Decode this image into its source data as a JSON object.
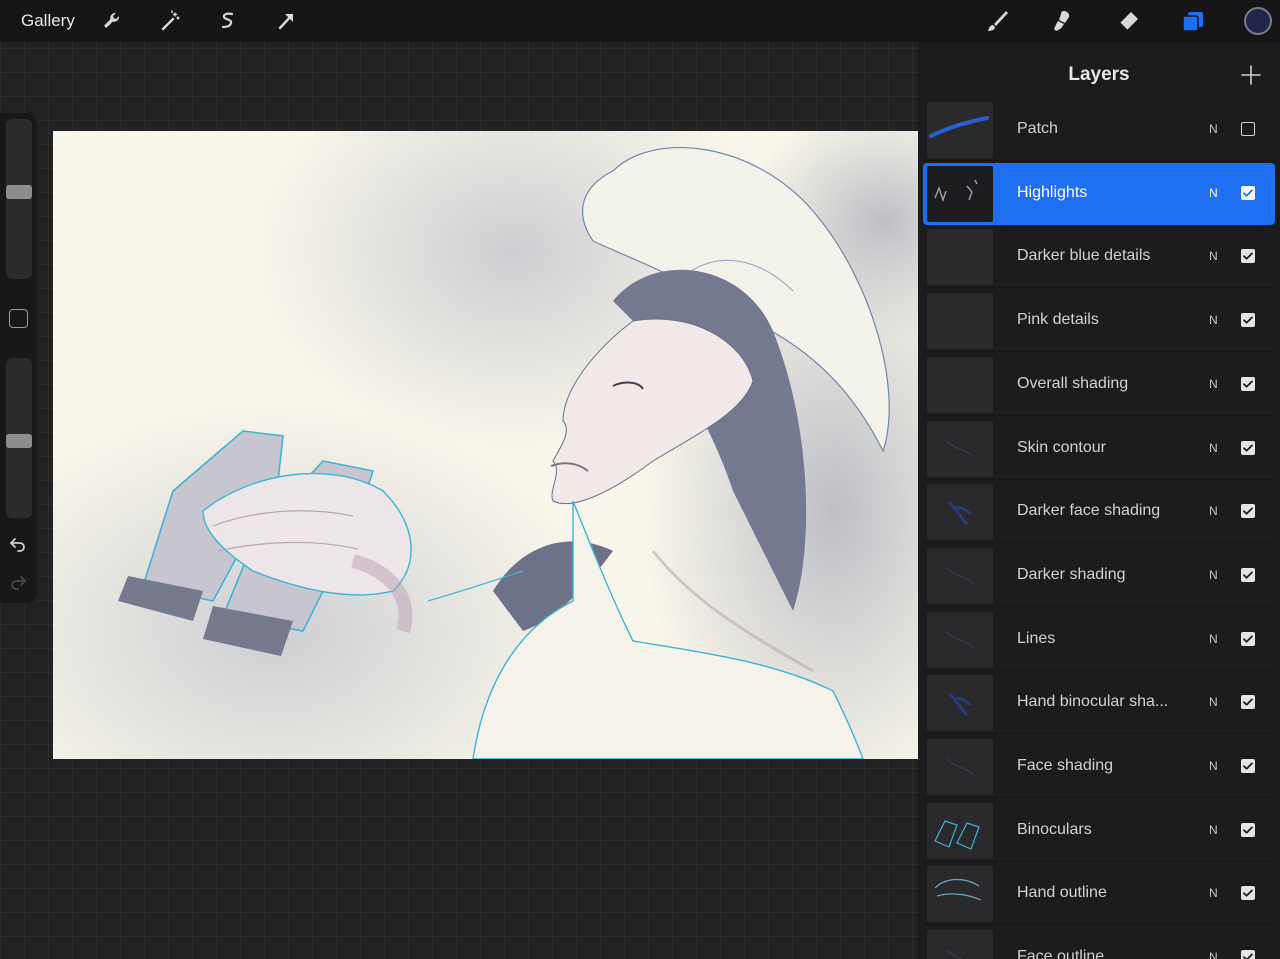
{
  "toolbar": {
    "gallery_label": "Gallery",
    "left_tools": [
      "wrench-icon",
      "magic-wand-icon",
      "selection-icon",
      "transform-arrow-icon"
    ],
    "right_tools": [
      "brush-icon",
      "smudge-icon",
      "eraser-icon",
      "layers-icon"
    ],
    "accent_color": "#1f6ff2",
    "current_color": "#24254a"
  },
  "sidebar": {
    "brush_size_level": 0.45,
    "opacity_level": 0.52,
    "icons": [
      "modify-square-icon",
      "undo-icon",
      "redo-icon"
    ]
  },
  "layers": {
    "title": "Layers",
    "add_icon": "plus-icon",
    "items": [
      {
        "name": "Patch",
        "mode": "N",
        "visible": false,
        "active": false,
        "thumb": "patch"
      },
      {
        "name": "Highlights",
        "mode": "N",
        "visible": true,
        "active": true,
        "thumb": "highlights"
      },
      {
        "name": "Darker blue details",
        "mode": "N",
        "visible": true,
        "active": false,
        "thumb": "empty"
      },
      {
        "name": "Pink details",
        "mode": "N",
        "visible": true,
        "active": false,
        "thumb": "empty"
      },
      {
        "name": "Overall shading",
        "mode": "N",
        "visible": true,
        "active": false,
        "thumb": "empty"
      },
      {
        "name": "Skin contour",
        "mode": "N",
        "visible": true,
        "active": false,
        "thumb": "faint"
      },
      {
        "name": "Darker face shading",
        "mode": "N",
        "visible": true,
        "active": false,
        "thumb": "blue"
      },
      {
        "name": "Darker shading",
        "mode": "N",
        "visible": true,
        "active": false,
        "thumb": "faint"
      },
      {
        "name": "Lines",
        "mode": "N",
        "visible": true,
        "active": false,
        "thumb": "faint"
      },
      {
        "name": "Hand binocular sha...",
        "mode": "N",
        "visible": true,
        "active": false,
        "thumb": "blue"
      },
      {
        "name": "Face shading",
        "mode": "N",
        "visible": true,
        "active": false,
        "thumb": "faint"
      },
      {
        "name": "Binoculars",
        "mode": "N",
        "visible": true,
        "active": false,
        "thumb": "binoculars"
      },
      {
        "name": "Hand outline",
        "mode": "N",
        "visible": true,
        "active": false,
        "thumb": "hand"
      },
      {
        "name": "Face outline",
        "mode": "N",
        "visible": true,
        "active": false,
        "thumb": "faint"
      }
    ]
  }
}
